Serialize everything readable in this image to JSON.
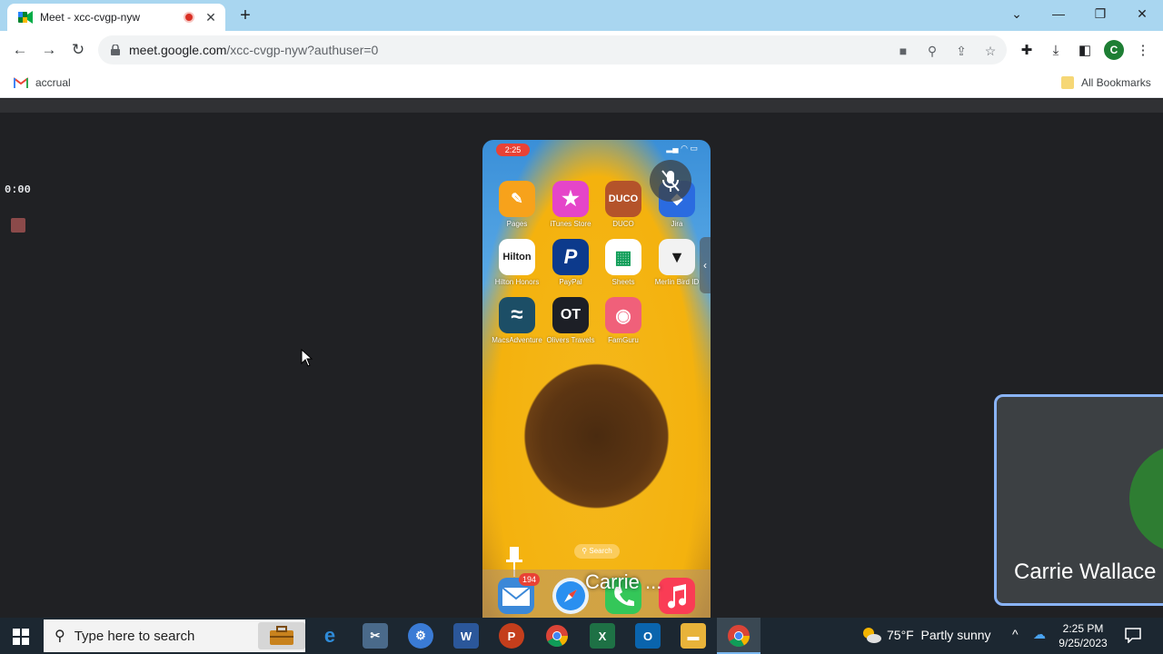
{
  "browser": {
    "tab_title": "Meet - xcc-cvgp-nyw",
    "url_host": "meet.google.com",
    "url_path": "/xcc-cvgp-nyw?authuser=0",
    "profile_initial": "C"
  },
  "bookmarks": {
    "items": [
      {
        "label": "accrual"
      }
    ],
    "all_bookmarks_label": "All Bookmarks"
  },
  "meet": {
    "timer": "0:00",
    "self_name": "Carrie Wallace",
    "phone_overlay_name": "Carrie ..."
  },
  "phone": {
    "status_time": "2:25",
    "apps": [
      {
        "label": "Pages",
        "glyph": "✎",
        "color": "#f7a21b"
      },
      {
        "label": "iTunes Store",
        "glyph": "★",
        "color": "#e545c9"
      },
      {
        "label": "DUCO",
        "glyph": "DUCO",
        "color": "#b4532a"
      },
      {
        "label": "Jira",
        "glyph": "",
        "color": "#2a6be0"
      },
      {
        "label": "Hilton Honors",
        "glyph": "Hilton",
        "color": "#ffffff"
      },
      {
        "label": "PayPal",
        "glyph": "P",
        "color": "#0c3a8c"
      },
      {
        "label": "Sheets",
        "glyph": "▦",
        "color": "#ffffff"
      },
      {
        "label": "Merlin Bird ID",
        "glyph": "",
        "color": "#f2f2f2"
      },
      {
        "label": "MacsAdventure",
        "glyph": "≈",
        "color": "#1c4e66"
      },
      {
        "label": "Olivers Travels",
        "glyph": "OT",
        "color": "#1d1f26"
      },
      {
        "label": "FamGuru",
        "glyph": "◉",
        "color": "#f0607a"
      }
    ],
    "search_label": "Search",
    "mail_badge": "194",
    "dock": [
      {
        "name": "mail",
        "color": "#3b88d8"
      },
      {
        "name": "safari",
        "color": "#e9f2fb"
      },
      {
        "name": "phone",
        "color": "#34c759"
      },
      {
        "name": "music",
        "color": "#fa3c55"
      }
    ]
  },
  "taskbar": {
    "search_placeholder": "Type here to search",
    "weather_temp": "75°F",
    "weather_text": "Partly sunny",
    "clock_time": "2:25 PM",
    "clock_date": "9/25/2023"
  },
  "colors": {
    "accent": "#8ab4f8",
    "record": "#d93025"
  }
}
